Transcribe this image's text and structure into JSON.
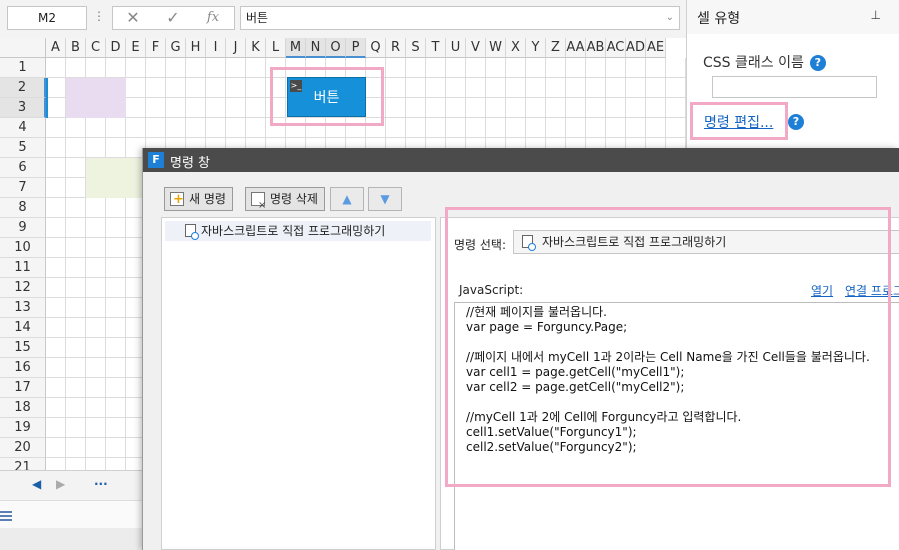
{
  "formula_bar": {
    "name_box": "M2",
    "formula_value": "버튼"
  },
  "grid": {
    "columns": [
      "A",
      "B",
      "C",
      "D",
      "E",
      "F",
      "G",
      "H",
      "I",
      "J",
      "K",
      "L",
      "M",
      "N",
      "O",
      "P",
      "Q",
      "R",
      "S",
      "T",
      "U",
      "V",
      "W",
      "X",
      "Y",
      "Z",
      "AA",
      "AB",
      "AC",
      "AD",
      "AE"
    ],
    "selected_columns": [
      "M",
      "N",
      "O",
      "P"
    ],
    "rows": [
      "1",
      "2",
      "3",
      "4",
      "5",
      "6",
      "7",
      "8",
      "9",
      "10",
      "11",
      "12",
      "13",
      "14",
      "15",
      "16",
      "17",
      "18",
      "19",
      "20",
      "21"
    ],
    "selected_rows": [
      "2",
      "3"
    ],
    "button_label": "버튼",
    "button_tag": ">_"
  },
  "sheet_tabs": {
    "prev": "◀",
    "next": "▶",
    "more": "···"
  },
  "right_panel": {
    "title": "셀 유형",
    "pin": "📌",
    "css_label": "CSS 클래스 이름",
    "help": "?",
    "edit_command_link": "명령 편집..."
  },
  "dialog": {
    "logo": "F",
    "title": "명령 창",
    "new_command": "새 명령",
    "delete_command": "명령 삭제",
    "up_arrow": "▲",
    "down_arrow": "▼",
    "commands": [
      "자바스크립트로 직접 프로그래밍하기"
    ],
    "command_select_label": "명령 선택:",
    "command_select_value": "자바스크립트로 직접 프로그래밍하기",
    "javascript_label": "JavaScript:",
    "open_link": "열기",
    "connect_link": "연결 프로그",
    "code": "//현재 페이지를 불러옵니다.\nvar page = Forguncy.Page;\n\n//페이지 내에서 myCell 1과 2이라는 Cell Name을 가진 Cell들을 불러옵니다.\nvar cell1 = page.getCell(\"myCell1\");\nvar cell2 = page.getCell(\"myCell2\");\n\n//myCell 1과 2에 Cell에 Forguncy라고 입력합니다.\ncell1.setValue(\"Forguncy1\");\ncell2.setValue(\"Forguncy2\");"
  },
  "colors": {
    "accent": "#1590d9",
    "highlight": "#f2a9c6",
    "link": "#1565c0",
    "dialog_title_bg": "#4b4b4b"
  }
}
